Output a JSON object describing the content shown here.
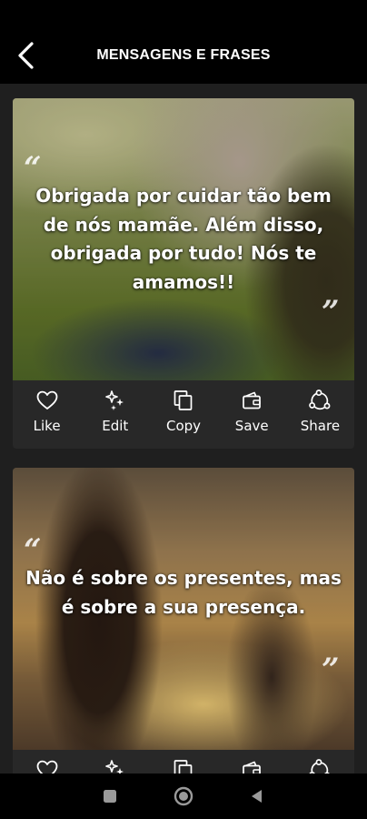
{
  "header": {
    "title": "MENSAGENS E FRASES",
    "back_icon": "back-arrow-icon"
  },
  "cards": [
    {
      "quote": "Obrigada por cuidar tão bem de nós mamãe. Além disso, obrigada por tudo! Nós te amamos!!",
      "open_quote": "“",
      "close_quote": "”"
    },
    {
      "quote": "Não é sobre os presentes, mas é sobre a sua presença.",
      "open_quote": "“",
      "close_quote": "”"
    }
  ],
  "actions": [
    {
      "label": "Like",
      "icon": "heart-icon"
    },
    {
      "label": "Edit",
      "icon": "sparkles-icon"
    },
    {
      "label": "Copy",
      "icon": "copy-icon"
    },
    {
      "label": "Save",
      "icon": "wallet-icon"
    },
    {
      "label": "Share",
      "icon": "share-icon"
    }
  ],
  "navigation": {
    "recent": "square-icon",
    "home": "circle-icon",
    "back": "triangle-back-icon"
  },
  "colors": {
    "app_bar": "#000000",
    "background": "#1f1f1f",
    "card": "#282828",
    "text": "#ffffff"
  }
}
